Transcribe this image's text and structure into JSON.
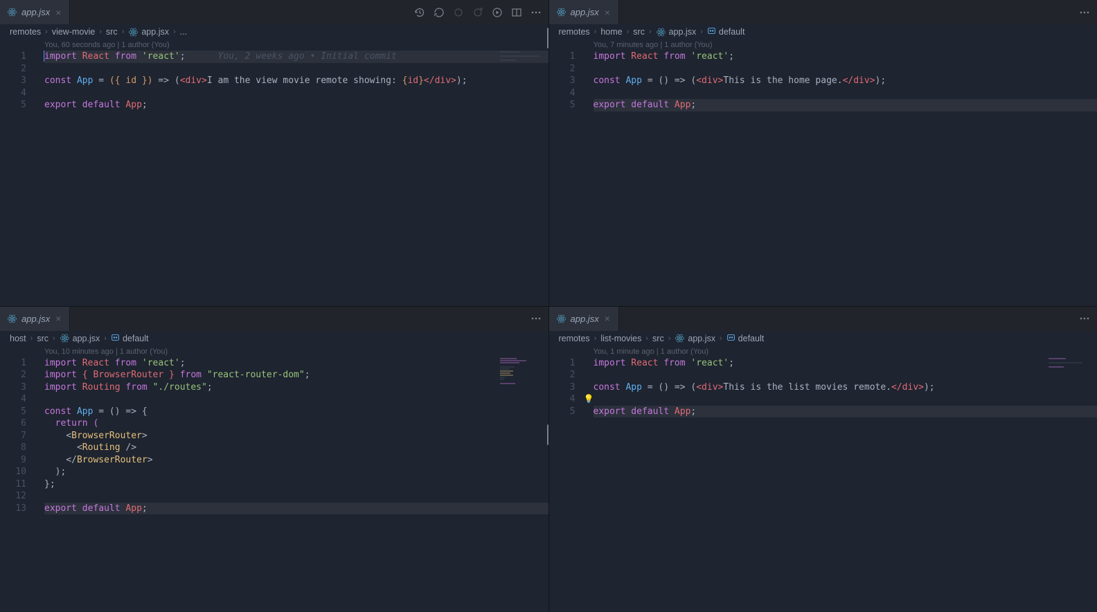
{
  "panes": [
    {
      "tab": "app.jsx",
      "toolbar_icons": [
        "history",
        "revert",
        "circle",
        "open",
        "play",
        "split",
        "more"
      ],
      "breadcrumbs": [
        "remotes",
        "view-movie",
        "src",
        "app.jsx",
        "..."
      ],
      "authorship": "You, 60 seconds ago | 1 author (You)",
      "blame_inline": "You, 2 weeks ago • Initial commit",
      "lines": [
        "1",
        "2",
        "3",
        "4",
        "5"
      ],
      "code": {
        "l1_import": "import",
        "l1_React": "React",
        "l1_from": "from",
        "l1_str": "'react'",
        "l1_semi": ";",
        "l3_const": "const",
        "l3_App": "App",
        "l3_eq": " = ",
        "l3_args": "({ id })",
        "l3_arrow": " => (",
        "l3_div_o": "<div>",
        "l3_txt": "I am the view movie remote showing: ",
        "l3_brace_o": "{",
        "l3_id": "id",
        "l3_brace_c": "}",
        "l3_div_c": "</div>",
        "l3_close": ");",
        "l5_export": "export",
        "l5_default": "default",
        "l5_App": "App",
        "l5_semi": ";"
      }
    },
    {
      "tab": "app.jsx",
      "toolbar_icons": [
        "more"
      ],
      "breadcrumbs": [
        "remotes",
        "home",
        "src",
        "app.jsx",
        "default"
      ],
      "authorship": "You, 7 minutes ago | 1 author (You)",
      "lines": [
        "1",
        "2",
        "3",
        "4",
        "5"
      ],
      "code": {
        "l1_import": "import",
        "l1_React": "React",
        "l1_from": "from",
        "l1_str": "'react'",
        "l1_semi": ";",
        "l3_const": "const",
        "l3_App": "App",
        "l3_eq": " = () => (",
        "l3_div_o": "<div>",
        "l3_txt": "This is the home page.",
        "l3_div_c": "</div>",
        "l3_close": ");",
        "l5_export": "export",
        "l5_default": "default",
        "l5_App": "App",
        "l5_semi": ";"
      }
    },
    {
      "tab": "app.jsx",
      "toolbar_icons": [
        "more"
      ],
      "breadcrumbs": [
        "host",
        "src",
        "app.jsx",
        "default"
      ],
      "authorship": "You, 10 minutes ago | 1 author (You)",
      "lines": [
        "1",
        "2",
        "3",
        "4",
        "5",
        "6",
        "7",
        "8",
        "9",
        "10",
        "11",
        "12",
        "13"
      ],
      "code": {
        "l1_import": "import",
        "l1_React": "React",
        "l1_from": "from",
        "l1_str": "'react'",
        "l1_semi": ";",
        "l2_import": "import",
        "l2_braces": "{ BrowserRouter }",
        "l2_from": "from",
        "l2_str": "\"react-router-dom\"",
        "l2_semi": ";",
        "l3_import": "import",
        "l3_Routing": "Routing",
        "l3_from": "from",
        "l3_str": "\"./routes\"",
        "l3_semi": ";",
        "l5_const": "const",
        "l5_App": "App",
        "l5_rest": " = () => {",
        "l6": "  return (",
        "l7_pad": "    ",
        "l7_o": "<",
        "l7_n": "BrowserRouter",
        "l7_c": ">",
        "l8_pad": "      ",
        "l8_o": "<",
        "l8_n": "Routing",
        "l8_c": " />",
        "l9_pad": "    ",
        "l9_o": "</",
        "l9_n": "BrowserRouter",
        "l9_c": ">",
        "l10": "  );",
        "l11": "};",
        "l13_export": "export",
        "l13_default": "default",
        "l13_App": "App",
        "l13_semi": ";"
      }
    },
    {
      "tab": "app.jsx",
      "toolbar_icons": [
        "more"
      ],
      "breadcrumbs": [
        "remotes",
        "list-movies",
        "src",
        "app.jsx",
        "default"
      ],
      "authorship": "You, 1 minute ago | 1 author (You)",
      "lines": [
        "1",
        "2",
        "3",
        "4",
        "5"
      ],
      "code": {
        "l1_import": "import",
        "l1_React": "React",
        "l1_from": "from",
        "l1_str": "'react'",
        "l1_semi": ";",
        "l3_const": "const",
        "l3_App": "App",
        "l3_eq": " = () => (",
        "l3_div_o": "<div>",
        "l3_txt": "This is the list movies remote.",
        "l3_div_c": "</div>",
        "l3_close": ");",
        "l5_export": "export",
        "l5_default": "default",
        "l5_App": "App",
        "l5_semi": ";"
      }
    }
  ]
}
